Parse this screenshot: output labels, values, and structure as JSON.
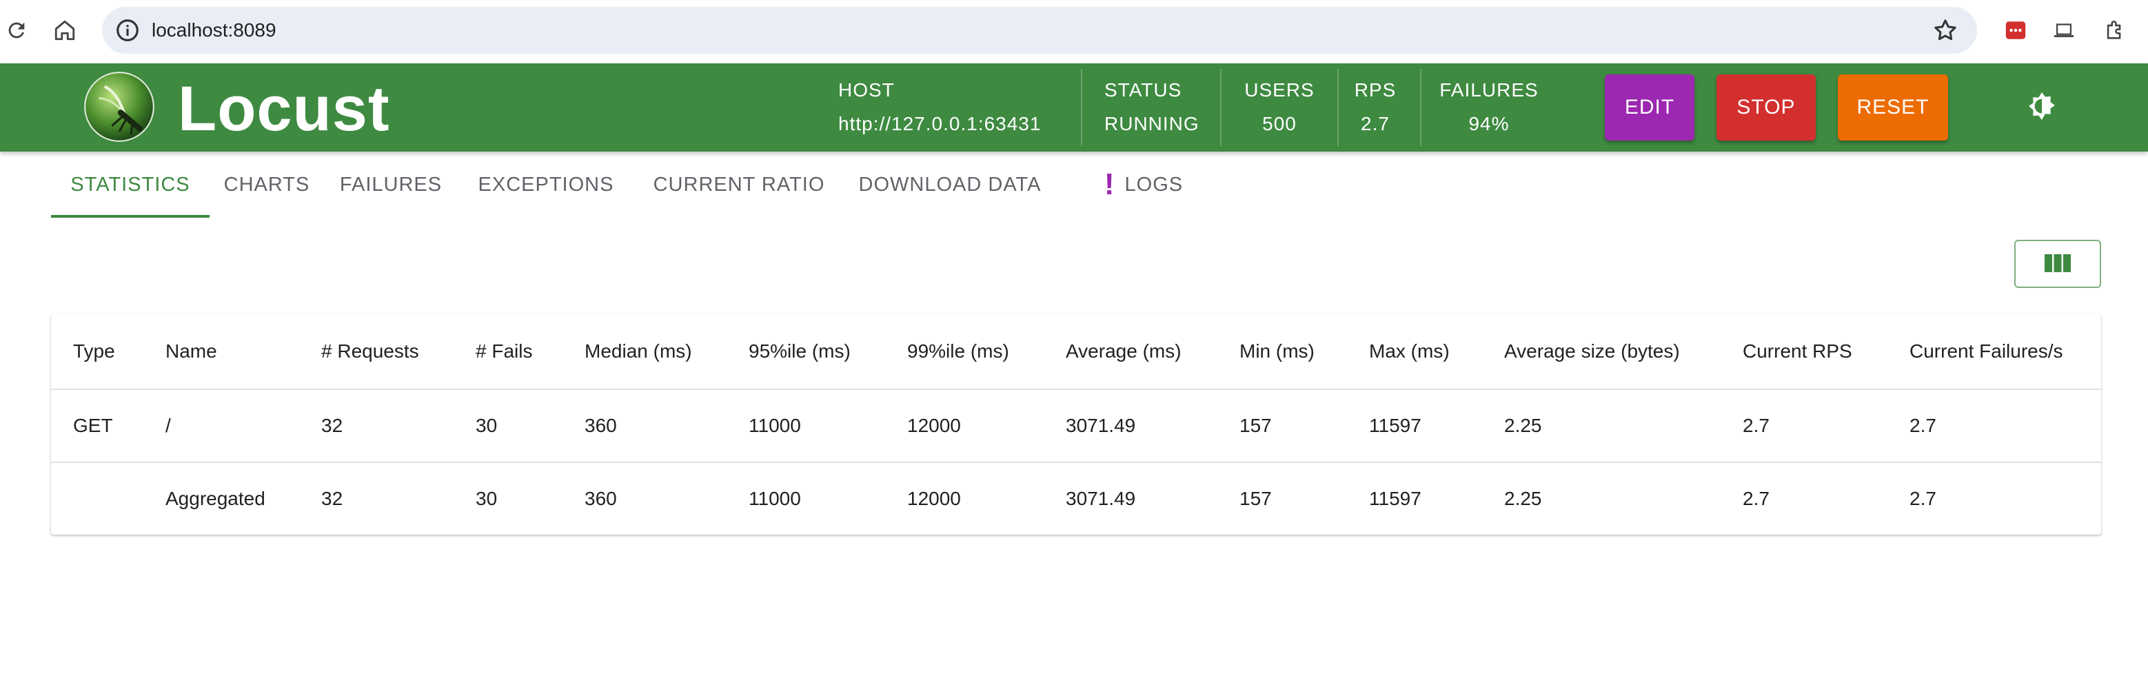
{
  "browser": {
    "url": "localhost:8089"
  },
  "app": {
    "name": "Locust",
    "stats": {
      "host_label": "HOST",
      "host_value": "http://127.0.0.1:63431",
      "status_label": "STATUS",
      "status_value": "RUNNING",
      "users_label": "USERS",
      "users_value": "500",
      "rps_label": "RPS",
      "rps_value": "2.7",
      "failures_label": "FAILURES",
      "failures_value": "94%"
    },
    "buttons": {
      "edit": "EDIT",
      "stop": "STOP",
      "reset": "RESET"
    },
    "colors": {
      "appbar": "#3e8a41",
      "edit": "#9c27b0",
      "stop": "#d32f2f",
      "reset": "#ed6c02"
    }
  },
  "tabs": [
    {
      "label": "STATISTICS",
      "active": true
    },
    {
      "label": "CHARTS",
      "active": false
    },
    {
      "label": "FAILURES",
      "active": false
    },
    {
      "label": "EXCEPTIONS",
      "active": false
    },
    {
      "label": "CURRENT RATIO",
      "active": false
    },
    {
      "label": "DOWNLOAD DATA",
      "active": false
    },
    {
      "label": "LOGS",
      "active": false,
      "badge": "!"
    }
  ],
  "table": {
    "columns": [
      "Type",
      "Name",
      "# Requests",
      "# Fails",
      "Median (ms)",
      "95%ile (ms)",
      "99%ile (ms)",
      "Average (ms)",
      "Min (ms)",
      "Max (ms)",
      "Average size (bytes)",
      "Current RPS",
      "Current Failures/s"
    ],
    "rows": [
      [
        "GET",
        "/",
        "32",
        "30",
        "360",
        "11000",
        "12000",
        "3071.49",
        "157",
        "11597",
        "2.25",
        "2.7",
        "2.7"
      ],
      [
        "",
        "Aggregated",
        "32",
        "30",
        "360",
        "11000",
        "12000",
        "3071.49",
        "157",
        "11597",
        "2.25",
        "2.7",
        "2.7"
      ]
    ]
  },
  "icons": [
    "reload-icon",
    "home-icon",
    "info-icon",
    "bookmark-star-icon",
    "password-manager-icon",
    "device-icon",
    "extensions-icon",
    "locust-logo-icon",
    "theme-toggle-icon",
    "columns-icon"
  ]
}
